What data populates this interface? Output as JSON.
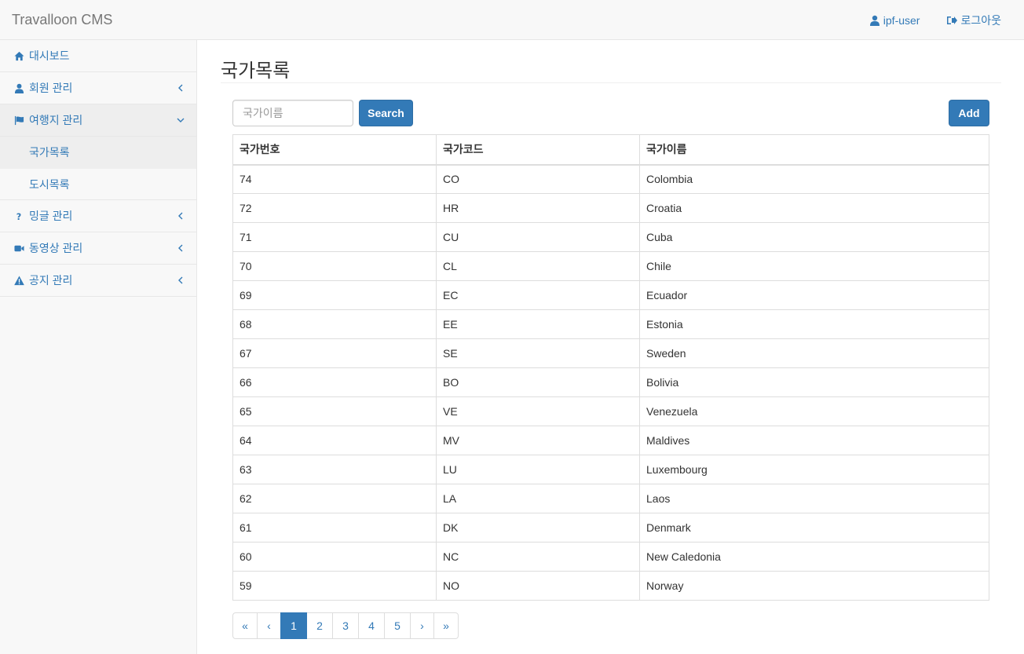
{
  "navbar": {
    "brand": "Travalloon CMS",
    "user_label": "ipf-user",
    "logout_label": "로그아웃"
  },
  "sidebar": {
    "items": [
      {
        "label": "대시보드",
        "icon": "home-icon"
      },
      {
        "label": "회원 관리",
        "icon": "user-icon"
      },
      {
        "label": "여행지 관리",
        "icon": "flag-icon"
      },
      {
        "label": "밍글 관리",
        "icon": "question-icon"
      },
      {
        "label": "동영상 관리",
        "icon": "video-camera-icon"
      },
      {
        "label": "공지 관리",
        "icon": "warning-icon"
      }
    ],
    "sub_items": [
      {
        "label": "국가목록"
      },
      {
        "label": "도시목록"
      }
    ]
  },
  "main": {
    "title": "국가목록",
    "search_placeholder": "국가이름",
    "search_label": "Search",
    "add_label": "Add"
  },
  "table": {
    "headers": [
      "국가번호",
      "국가코드",
      "국가이름"
    ],
    "rows": [
      [
        "74",
        "CO",
        "Colombia"
      ],
      [
        "72",
        "HR",
        "Croatia"
      ],
      [
        "71",
        "CU",
        "Cuba"
      ],
      [
        "70",
        "CL",
        "Chile"
      ],
      [
        "69",
        "EC",
        "Ecuador"
      ],
      [
        "68",
        "EE",
        "Estonia"
      ],
      [
        "67",
        "SE",
        "Sweden"
      ],
      [
        "66",
        "BO",
        "Bolivia"
      ],
      [
        "65",
        "VE",
        "Venezuela"
      ],
      [
        "64",
        "MV",
        "Maldives"
      ],
      [
        "63",
        "LU",
        "Luxembourg"
      ],
      [
        "62",
        "LA",
        "Laos"
      ],
      [
        "61",
        "DK",
        "Denmark"
      ],
      [
        "60",
        "NC",
        "New Caledonia"
      ],
      [
        "59",
        "NO",
        "Norway"
      ]
    ]
  },
  "pagination": {
    "first": "«",
    "prev": "‹",
    "pages": [
      "1",
      "2",
      "3",
      "4",
      "5"
    ],
    "current": "1",
    "next": "›",
    "last": "»"
  },
  "colors": {
    "accent": "#337ab7",
    "navbar_bg": "#f8f8f8",
    "border": "#ddd"
  }
}
